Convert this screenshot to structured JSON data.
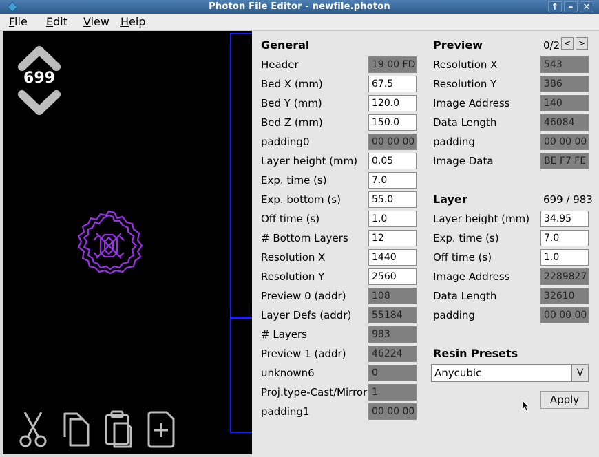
{
  "window": {
    "title": "Photon File Editor - newfile.photon",
    "controls": [
      "↑",
      "–",
      "✕"
    ]
  },
  "menu": [
    {
      "label": "File",
      "mnemonic": "F",
      "rest": "ile"
    },
    {
      "label": "Edit",
      "mnemonic": "E",
      "rest": "dit"
    },
    {
      "label": "View",
      "mnemonic": "V",
      "rest": "iew"
    },
    {
      "label": "Help",
      "mnemonic": "H",
      "rest": "elp"
    }
  ],
  "viewer": {
    "layer_number": "699",
    "icons": [
      "chevron-up-icon",
      "chevron-down-icon",
      "scissors-icon",
      "copy-icon",
      "paste-icon",
      "add-file-icon"
    ],
    "colors": {
      "background": "#000000",
      "print_outline": "#9a30e8",
      "frame": "#1a1aff"
    }
  },
  "general": {
    "title": "General",
    "rows": [
      {
        "label": "Header",
        "value": "19 00 FD",
        "readonly": true
      },
      {
        "label": "Bed X (mm)",
        "value": "67.5",
        "readonly": false
      },
      {
        "label": "Bed Y (mm)",
        "value": "120.0",
        "readonly": false
      },
      {
        "label": "Bed Z (mm)",
        "value": "150.0",
        "readonly": false
      },
      {
        "label": "padding0",
        "value": "00 00 00",
        "readonly": true
      },
      {
        "label": "Layer height (mm)",
        "value": "0.05",
        "readonly": false
      },
      {
        "label": "Exp. time (s)",
        "value": "7.0",
        "readonly": false
      },
      {
        "label": "Exp. bottom (s)",
        "value": "55.0",
        "readonly": false
      },
      {
        "label": "Off time (s)",
        "value": "1.0",
        "readonly": false
      },
      {
        "label": "# Bottom Layers",
        "value": "12",
        "readonly": false
      },
      {
        "label": "Resolution X",
        "value": "1440",
        "readonly": false
      },
      {
        "label": "Resolution Y",
        "value": "2560",
        "readonly": false
      },
      {
        "label": "Preview 0 (addr)",
        "value": "108",
        "readonly": true
      },
      {
        "label": "Layer Defs (addr)",
        "value": "55184",
        "readonly": true
      },
      {
        "label": "# Layers",
        "value": "983",
        "readonly": true
      },
      {
        "label": "Preview 1 (addr)",
        "value": "46224",
        "readonly": true
      },
      {
        "label": "unknown6",
        "value": "0",
        "readonly": true
      },
      {
        "label": "Proj.type-Cast/Mirror",
        "value": "1",
        "readonly": true
      },
      {
        "label": "padding1",
        "value": "00 00 00",
        "readonly": true
      }
    ]
  },
  "preview": {
    "title": "Preview",
    "counter": "0/2",
    "prev_label": "<",
    "next_label": ">",
    "rows": [
      {
        "label": "Resolution X",
        "value": "543",
        "readonly": true
      },
      {
        "label": "Resolution Y",
        "value": "386",
        "readonly": true
      },
      {
        "label": "Image Address",
        "value": "140",
        "readonly": true
      },
      {
        "label": "Data Length",
        "value": "46084",
        "readonly": true
      },
      {
        "label": "padding",
        "value": "00 00 00",
        "readonly": true
      },
      {
        "label": "Image Data",
        "value": "BE F7 FE",
        "readonly": true
      }
    ]
  },
  "layer": {
    "title": "Layer",
    "counter": "699 / 983",
    "rows": [
      {
        "label": "Layer height (mm)",
        "value": "34.95",
        "readonly": false
      },
      {
        "label": "Exp. time (s)",
        "value": "7.0",
        "readonly": false
      },
      {
        "label": "Off time (s)",
        "value": "1.0",
        "readonly": false
      },
      {
        "label": "Image Address",
        "value": "2289827",
        "readonly": true
      },
      {
        "label": "Data Length",
        "value": "32610",
        "readonly": true
      },
      {
        "label": "padding",
        "value": "00 00 00",
        "readonly": true
      }
    ]
  },
  "resin": {
    "title": "Resin Presets",
    "selected": "Anycubic",
    "dropdown_label": "V",
    "apply_label": "Apply"
  }
}
